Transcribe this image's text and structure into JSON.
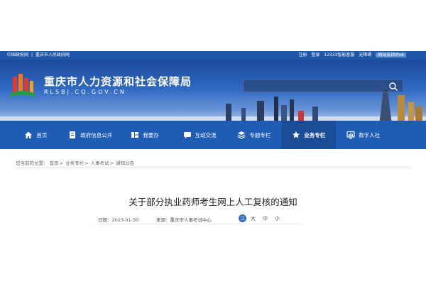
{
  "topbar": {
    "left_links": [
      "中国政府网",
      "|",
      "重庆市人民政府网"
    ],
    "right_links": [
      "注册",
      "登录",
      "12333智能客服",
      "无障碍"
    ],
    "ipv6_badge": "网站支持IPv6"
  },
  "header": {
    "site_name": "重庆市人力资源和社会保障局",
    "site_domain": "RLSBJ.CQ.GOV.CN",
    "search_placeholder": ""
  },
  "nav": {
    "items": [
      {
        "label": "首页",
        "icon": "home-icon"
      },
      {
        "label": "政府信息公开",
        "icon": "document-icon"
      },
      {
        "label": "我要办",
        "icon": "service-icon"
      },
      {
        "label": "互动交流",
        "icon": "chat-icon"
      },
      {
        "label": "专题专栏",
        "icon": "layers-icon"
      },
      {
        "label": "业务专栏",
        "icon": "star-icon",
        "active": true
      },
      {
        "label": "数字人社",
        "icon": "chart-icon"
      }
    ]
  },
  "breadcrumb": {
    "prefix": "您当前的位置：",
    "items": [
      "首页",
      "业务专栏",
      "人事考试",
      "通知公告"
    ],
    "separator": ">"
  },
  "article": {
    "title": "关于部分执业药师考生网上人工复核的通知",
    "date": "日期：2023-01-30",
    "source": "来源：重庆市人事考试中心",
    "font_size_icon": "江",
    "font_size_options": [
      "大",
      "中",
      "小"
    ]
  },
  "colors": {
    "nav_bg": "#1f5cb4",
    "nav_active": "#1b4c98",
    "topbar_bg": "#1f56a8"
  }
}
